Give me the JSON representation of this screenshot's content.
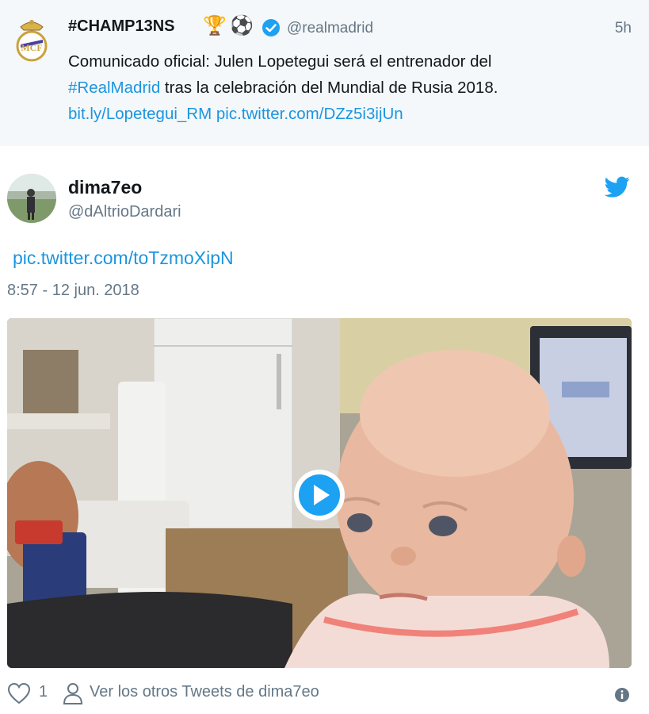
{
  "quoted_tweet": {
    "display_name": "#CHAMP13NS",
    "name_emojis": [
      "🏆",
      "⚽"
    ],
    "handle": "@realmadrid",
    "time": "5h",
    "text_line1": "Comunicado oficial: Julen Lopetegui será el entrenador del",
    "hashtag": "#RealMadrid",
    "text_line2": " tras la celebración del Mundial de Rusia 2018.",
    "link1": "bit.ly/Lopetegui_RM",
    "link2": "pic.twitter.com/DZz5i3ijUn"
  },
  "tweet": {
    "display_name": "dima7eo",
    "handle": "@dAltrioDardari",
    "pic_link": "pic.twitter.com/toTzmoXipN",
    "date": "8:57 - 12 jun. 2018"
  },
  "footer": {
    "like_count": "1",
    "more_tweets": "Ver los otros Tweets de dima7eo"
  },
  "colors": {
    "link": "#1b95e0",
    "secondary_text": "#657786",
    "quoted_bg": "#f5f8fa",
    "twitter_blue": "#1da1f2"
  },
  "icons": [
    "real-madrid-crest-icon",
    "trophy-icon",
    "soccer-ball-icon",
    "verified-badge-icon",
    "twitter-bird-icon",
    "play-icon",
    "heart-icon",
    "person-icon",
    "info-icon"
  ]
}
